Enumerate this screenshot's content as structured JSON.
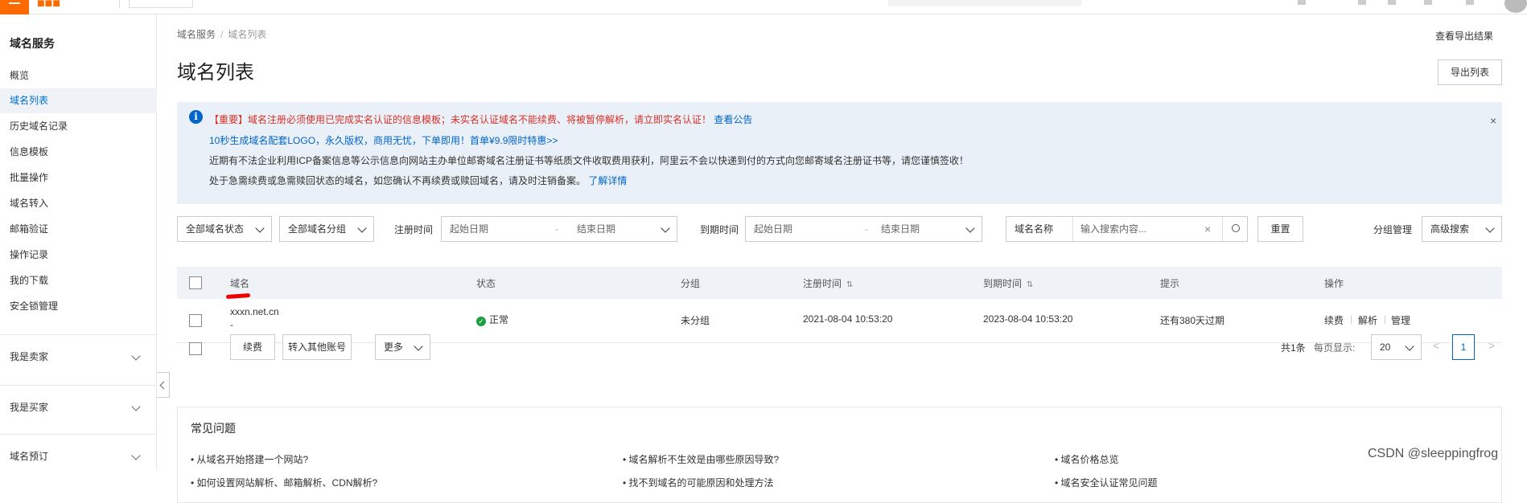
{
  "sidebar": {
    "title": "域名服务",
    "items": [
      {
        "label": "概览"
      },
      {
        "label": "域名列表"
      },
      {
        "label": "历史域名记录"
      },
      {
        "label": "信息模板"
      },
      {
        "label": "批量操作"
      },
      {
        "label": "域名转入"
      },
      {
        "label": "邮箱验证"
      },
      {
        "label": "操作记录"
      },
      {
        "label": "我的下载"
      },
      {
        "label": "安全锁管理"
      }
    ],
    "groups": [
      {
        "label": "我是卖家"
      },
      {
        "label": "我是买家"
      },
      {
        "label": "域名预订"
      }
    ]
  },
  "breadcrumb": {
    "root": "域名服务",
    "separator": "/",
    "current": "域名列表"
  },
  "header": {
    "title": "域名列表",
    "export_results_link": "查看导出结果",
    "export_button": "导出列表"
  },
  "notice": {
    "line1_important": "【重要】域名注册必须使用已完成实名认证的信息模板；未实名认证域名不能续费、将被暂停解析，请立即实名认证！",
    "line1_link": "查看公告",
    "line2_promo": "10秒生成域名配套LOGO，永久版权，商用无忧，下单即用！首单¥9.9限时特惠>>",
    "line3": "近期有不法企业利用ICP备案信息等公示信息向网站主办单位邮寄域名注册证书等纸质文件收取费用获利，阿里云不会以快递到付的方式向您邮寄域名注册证书等，请您谨慎签收！",
    "line4": "处于急需续费或急需赎回状态的域名，如您确认不再续费或赎回域名，请及时注销备案。",
    "line4_link": "了解详情",
    "close": "×"
  },
  "filters": {
    "status_select": "全部域名状态",
    "group_select": "全部域名分组",
    "reg_time_label": "注册时间",
    "reg_start": "起始日期",
    "reg_end": "结束日期",
    "date_sep": "-",
    "exp_time_label": "到期时间",
    "exp_start": "起始日期",
    "exp_end": "结束日期",
    "search_field": "域名名称",
    "search_placeholder": "输入搜索内容...",
    "clear": "×",
    "reset_button": "重置",
    "group_manage": "分组管理",
    "advanced_search": "高级搜索"
  },
  "table": {
    "columns": [
      "域名",
      "状态",
      "分组",
      "注册时间",
      "到期时间",
      "提示",
      "操作"
    ],
    "sort_glyph": "⇅",
    "rows": [
      {
        "domain": "xxxn.net.cn",
        "domain_sub": "-",
        "status": "正常",
        "group": "未分组",
        "reg_time": "2021-08-04 10:53:20",
        "exp_time": "2023-08-04 10:53:20",
        "hint": "还有380天过期",
        "actions": [
          "续费",
          "解析",
          "管理"
        ]
      }
    ]
  },
  "bulk": {
    "renew_button": "续费",
    "transfer_button": "转入其他账号",
    "more_button": "更多"
  },
  "pagination": {
    "total": "共1条",
    "per_page_label": "每页显示:",
    "per_page_value": "20",
    "current_page": "1"
  },
  "faq": {
    "title": "常见问题",
    "items": [
      "• 从域名开始搭建一个网站?",
      "• 域名解析不生效是由哪些原因导致?",
      "• 域名价格总览",
      "• 如何设置网站解析、邮箱解析、CDN解析?",
      "• 找不到域名的可能原因和处理方法",
      "• 域名安全认证常见问题"
    ]
  },
  "watermark": "CSDN @sleeppingfrog",
  "icons": [
    "menu-icon",
    "info-icon",
    "close-icon",
    "chevron-down-icon",
    "search-icon",
    "status-ok-icon",
    "chevron-left-icon",
    "chevron-right-icon"
  ],
  "colors": {
    "accent": "#0064c8",
    "brand": "#ff6a00",
    "danger": "#d93026",
    "success": "#1e9e3e",
    "notice_bg": "#eaf0f8"
  }
}
